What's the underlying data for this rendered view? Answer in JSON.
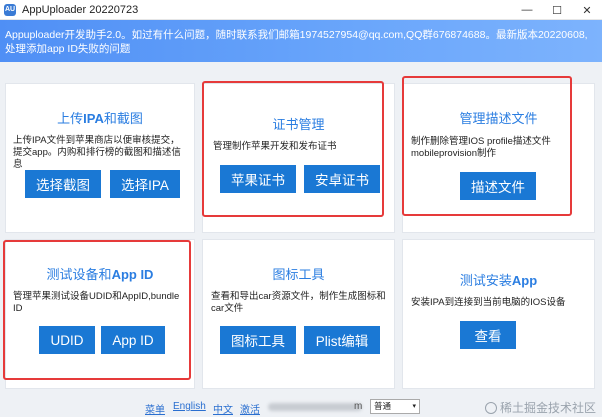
{
  "window": {
    "title": "AppUploader 20220723",
    "icon_glyph": "AU",
    "minimize": "—",
    "maximize": "☐",
    "close": "✕"
  },
  "banner": {
    "text": "Appuploader开发助手2.0。如过有什么问题，随时联系我们邮箱1974527954@qq.com,QQ群676874688。最新版本20220608,处理添加app ID失败的问题"
  },
  "cards": {
    "upload": {
      "title_part1": "上传",
      "title_bold": "IPA",
      "title_part2": "和截图",
      "desc": "上传IPA文件到苹果商店以便审核提交，提交app。内购和排行榜的截图和描述信息",
      "btn1": "选择截图",
      "btn2": "选择IPA"
    },
    "cert": {
      "title": "证书管理",
      "desc": "管理制作苹果开发和发布证书",
      "btn1": "苹果证书",
      "btn2": "安卓证书"
    },
    "profile": {
      "title": "管理描述文件",
      "desc": "制作删除管理IOS profile描述文件mobileprovision制作",
      "btn1": "描述文件"
    },
    "device": {
      "title_part1": "测试设备和",
      "title_bold": "App ID",
      "desc": "管理苹果测试设备UDID和AppID,bundle ID",
      "btn1": "UDID",
      "btn2": "App ID"
    },
    "icon": {
      "title": "图标工具",
      "desc": "查看和导出car资源文件，制作生成图标和car文件",
      "btn1": "图标工具",
      "btn2": "Plist编辑"
    },
    "install": {
      "title_part1": "测试安装",
      "title_bold": "App",
      "desc": "安装IPA到连接到当前电脑的IOS设备",
      "btn1": "查看"
    }
  },
  "footer": {
    "link_menu": "菜单",
    "link_english": "English",
    "link_chinese": "中文",
    "link_activate": "激活",
    "email_suffix": "m",
    "lang_selected": "普通",
    "watermark": "稀土掘金技术社区"
  },
  "colors": {
    "accent": "#1a78d4",
    "title_blue": "#2a7de1",
    "highlight_red": "#e63a3a"
  }
}
